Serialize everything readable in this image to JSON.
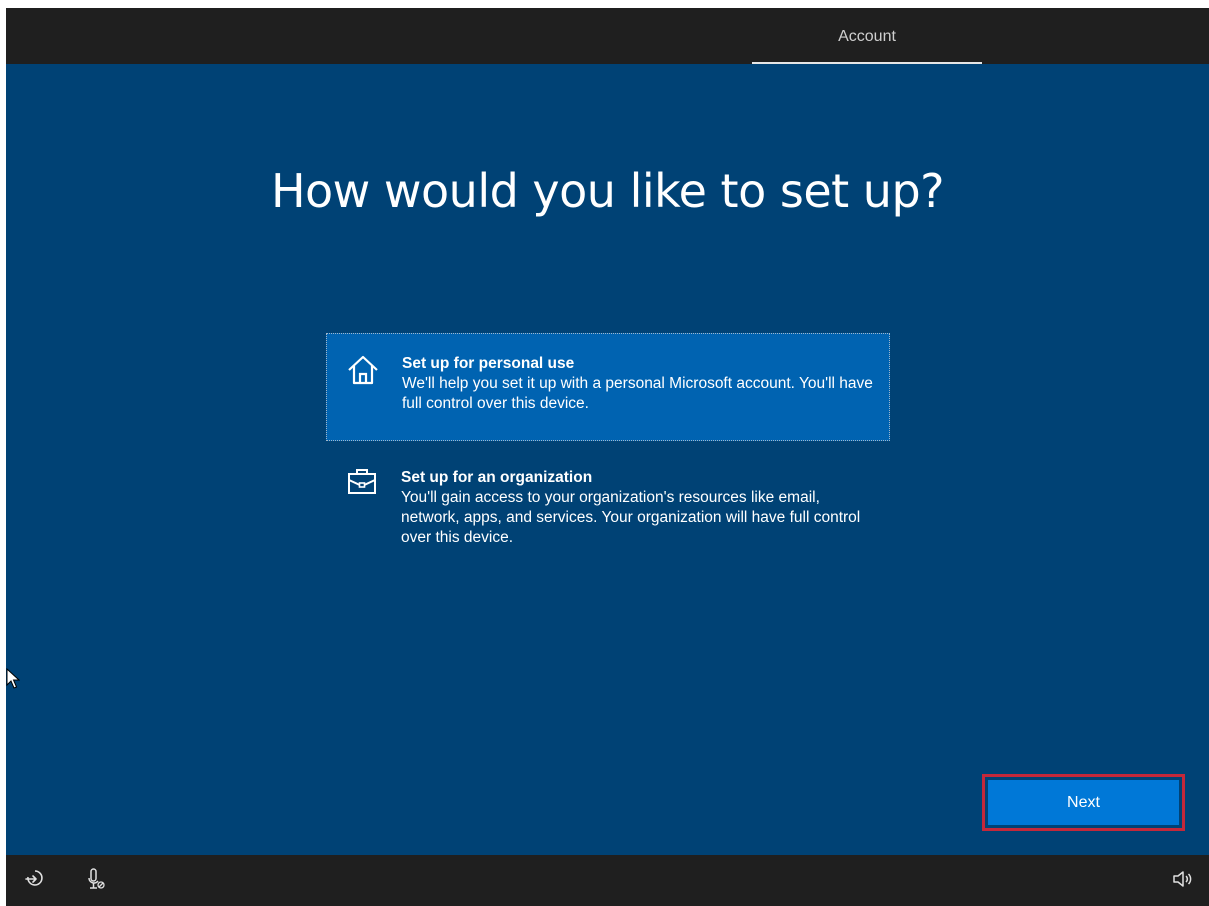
{
  "header": {
    "tab_label": "Account"
  },
  "main": {
    "title": "How would you like to set up?",
    "options": [
      {
        "title": "Set up for personal use",
        "description": "We'll help you set it up with a personal Microsoft account. You'll have full control over this device.",
        "icon": "home-icon",
        "selected": true
      },
      {
        "title": "Set up for an organization",
        "description": "You'll gain access to your organization's resources like email, network, apps, and services. Your organization will have full control over this device.",
        "icon": "briefcase-icon",
        "selected": false
      }
    ],
    "next_label": "Next"
  },
  "footer": {
    "icons": [
      "ease-of-access-icon",
      "microphone-off-icon",
      "volume-icon"
    ]
  },
  "colors": {
    "background": "#004275",
    "selected_option": "#0063b1",
    "button": "#0078d7",
    "highlight_border": "#c4283a",
    "chrome": "#1f1f1f"
  }
}
